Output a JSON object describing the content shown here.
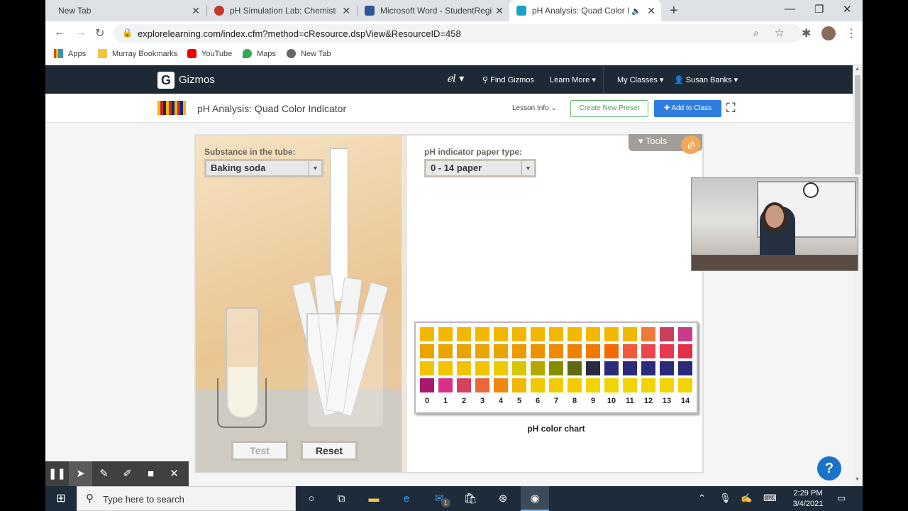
{
  "tabs": [
    {
      "title": "New Tab",
      "active": false
    },
    {
      "title": "pH Simulation Lab: Chemistry - B",
      "active": false
    },
    {
      "title": "Microsoft Word - StudentRegistra",
      "active": false
    },
    {
      "title": "pH Analysis: Quad Color Indic",
      "active": true
    }
  ],
  "address": {
    "url": "explorelearning.com/index.cfm?method=cResource.dspView&ResourceID=458"
  },
  "bookmarks": [
    "Apps",
    "Murray Bookmarks",
    "YouTube",
    "Maps",
    "New Tab"
  ],
  "header": {
    "logo_letter": "G",
    "logo_text": "Gizmos",
    "find_gizmos": "Find Gizmos",
    "learn_more": "Learn More",
    "my_classes": "My Classes",
    "user": "Susan Banks"
  },
  "subheader": {
    "title": "pH Analysis: Quad Color Indicator",
    "lesson_info": "Lesson Info",
    "create_preset": "Create New Preset",
    "add_to_class": "Add to Class"
  },
  "sim": {
    "substance_label": "Substance in the tube:",
    "substance_value": "Baking soda",
    "paper_label": "pH indicator paper type:",
    "paper_value": "0 - 14 paper",
    "tools_label": "Tools",
    "test_button": "Test",
    "reset_button": "Reset",
    "chart_caption": "pH color chart",
    "ph_values": [
      "0",
      "1",
      "2",
      "3",
      "4",
      "5",
      "6",
      "7",
      "8",
      "9",
      "10",
      "11",
      "12",
      "13",
      "14"
    ],
    "chart_rows": [
      [
        "#f2b800",
        "#f2b800",
        "#f2b800",
        "#f2b800",
        "#f2b800",
        "#f2b800",
        "#f2b800",
        "#f2b800",
        "#f2b800",
        "#f2b800",
        "#f2b800",
        "#f2b800",
        "#ef7b3a",
        "#c7415a",
        "#c93c8a"
      ],
      [
        "#e8a400",
        "#e8a400",
        "#e8a400",
        "#e8a400",
        "#e8a400",
        "#eb9c00",
        "#ec9400",
        "#ec8a00",
        "#ee8200",
        "#f07a00",
        "#f26a00",
        "#ef5a3a",
        "#e8464c",
        "#e63850",
        "#e42f48"
      ],
      [
        "#f2c400",
        "#f2c400",
        "#f2c400",
        "#f2c400",
        "#eecb00",
        "#dac600",
        "#b4a800",
        "#8a8c00",
        "#5f6a10",
        "#2a2a40",
        "#2b2b7a",
        "#2b2b7a",
        "#2b2b7a",
        "#2b2b7a",
        "#2b2b7a"
      ],
      [
        "#a8186c",
        "#d8308a",
        "#d84060",
        "#e8683c",
        "#ef8810",
        "#f2b800",
        "#f2c800",
        "#f2cc00",
        "#f2cc00",
        "#f2d400",
        "#f2d400",
        "#f2d400",
        "#f2d400",
        "#f2d400",
        "#f2d400"
      ]
    ]
  },
  "taskbar": {
    "search_placeholder": "Type here to search",
    "time": "2:29 PM",
    "date": "3/4/2021",
    "mail_badge": "1"
  },
  "help": "?"
}
